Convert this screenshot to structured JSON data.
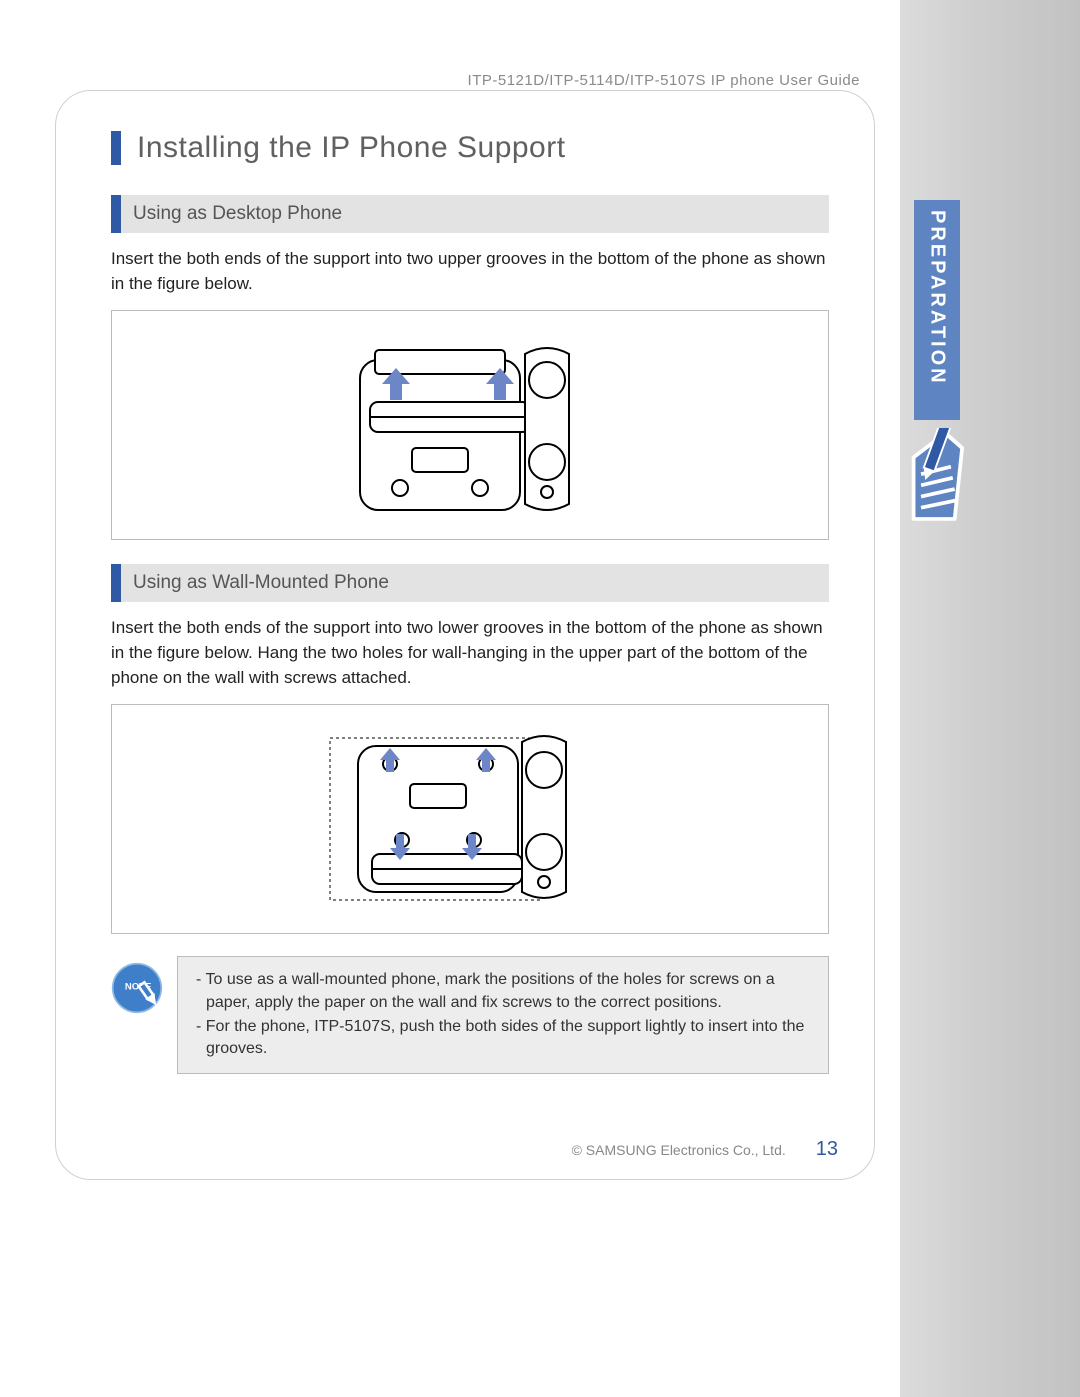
{
  "header": "ITP-5121D/ITP-5114D/ITP-5107S IP phone User Guide",
  "tab_label": "PREPARATION",
  "title": "Installing the IP Phone Support",
  "section1": {
    "heading": "Using as Desktop Phone",
    "text": "Insert the both ends of the support into two upper grooves in the bottom of the phone as shown in the figure below."
  },
  "section2": {
    "heading": "Using as Wall-Mounted Phone",
    "text": "Insert the both ends of the support into two lower grooves in the bottom of the phone as shown in the figure below. Hang the two holes for wall-hanging in the upper part of the bottom of the phone on the wall with screws attached."
  },
  "note": {
    "badge": "NOTE",
    "line1": "- To use as a wall-mounted phone, mark the positions of the holes for screws on a paper, apply the paper on the wall and fix screws to the correct positions.",
    "line2": "- For the phone, ITP-5107S, push the both sides of the support lightly to insert into the grooves."
  },
  "footer": {
    "copyright": "© SAMSUNG Electronics Co., Ltd.",
    "page": "13"
  }
}
